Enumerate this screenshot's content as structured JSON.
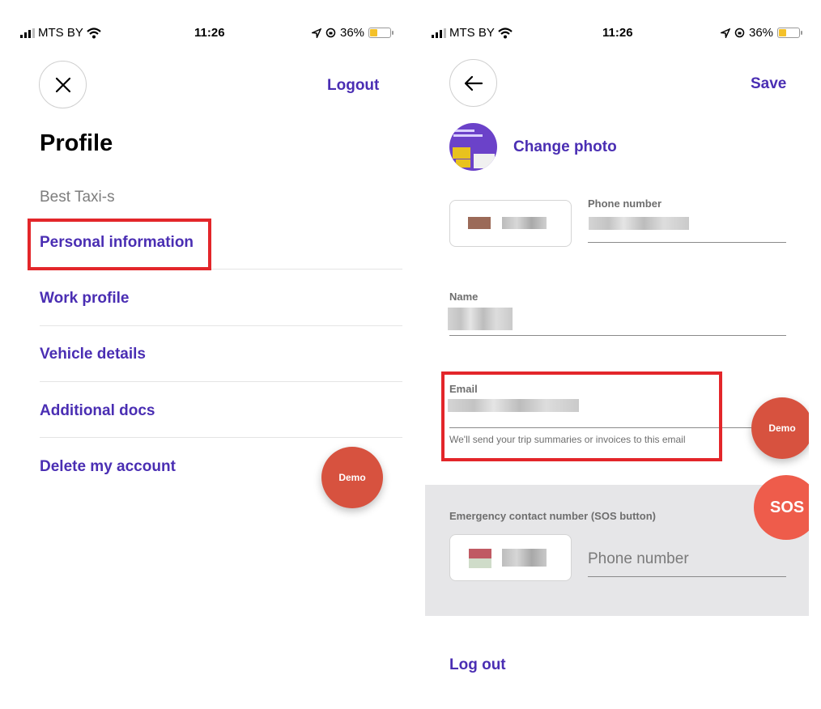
{
  "status_bar": {
    "carrier": "MTS BY",
    "time": "11:26",
    "battery": "36%"
  },
  "left_screen": {
    "logout_label": "Logout",
    "title": "Profile",
    "company": "Best Taxi-s",
    "menu": [
      {
        "label": "Personal information"
      },
      {
        "label": "Work profile"
      },
      {
        "label": "Vehicle details"
      },
      {
        "label": "Additional docs"
      },
      {
        "label": "Delete my account"
      }
    ],
    "demo_label": "Demo"
  },
  "right_screen": {
    "save_label": "Save",
    "change_photo_label": "Change photo",
    "phone_label": "Phone number",
    "name_label": "Name",
    "email_label": "Email",
    "email_hint": "We'll send your trip summaries or invoices to this email",
    "demo_label": "Demo",
    "emergency_label": "Emergency contact number (SOS button)",
    "emergency_placeholder": "Phone number",
    "sos_label": "SOS",
    "logout_label": "Log out"
  },
  "colors": {
    "accent": "#4a2eb3",
    "highlight": "#e3262a",
    "demo_button": "#d7523f",
    "sos_button": "#ee5c4b"
  }
}
